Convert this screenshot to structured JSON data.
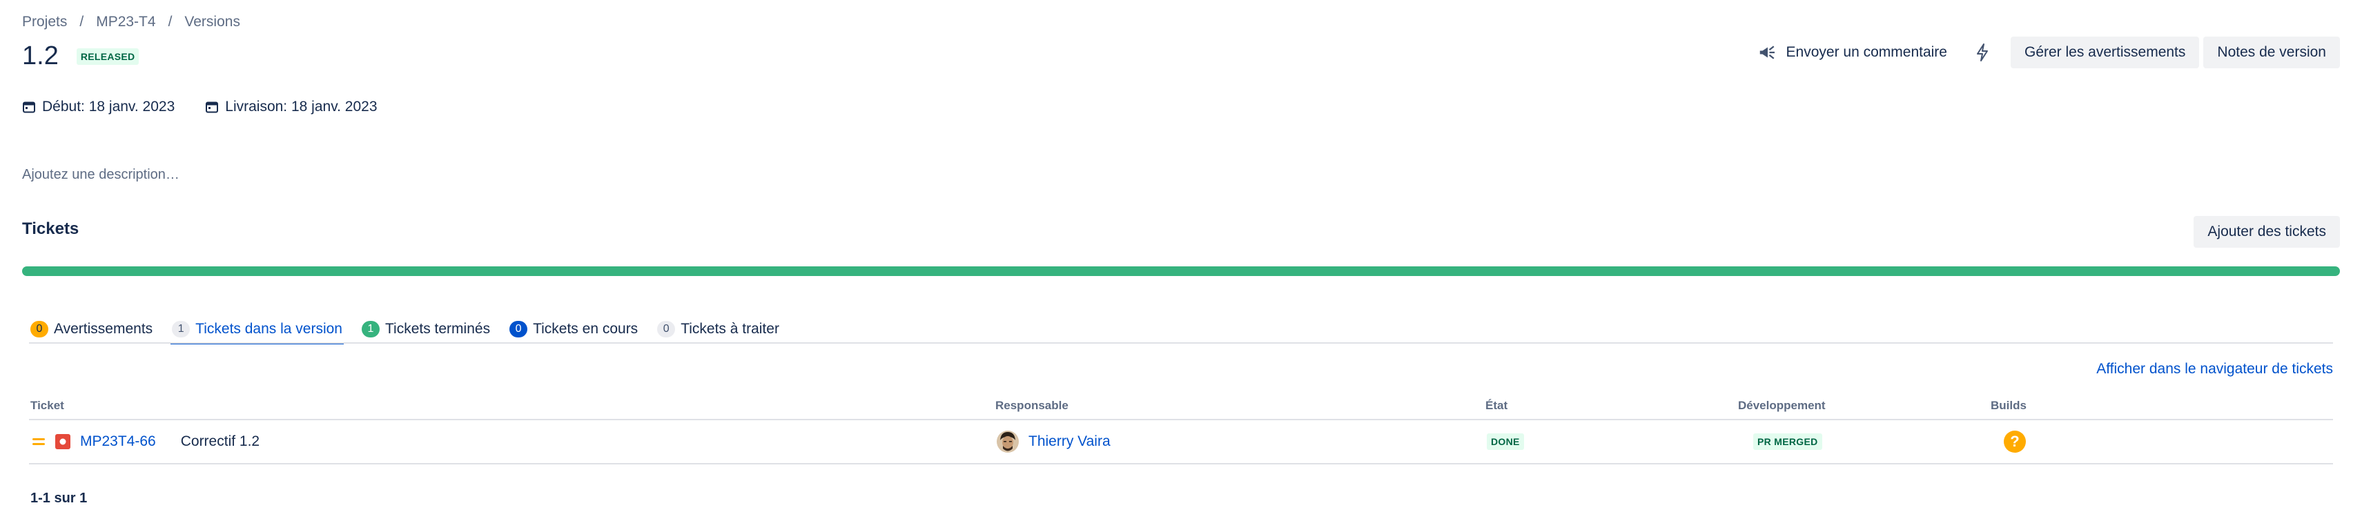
{
  "breadcrumb": [
    "Projets",
    "MP23-T4",
    "Versions"
  ],
  "version": {
    "title": "1.2",
    "status": "RELEASED",
    "start_date": "Début: 18 janv. 2023",
    "release_date": "Livraison: 18 janv. 2023",
    "description_placeholder": "Ajoutez une description…"
  },
  "header_actions": {
    "feedback": "Envoyer un commentaire",
    "bolt_icon": "lightning-icon",
    "manage_warnings": "Gérer les avertissements",
    "release_notes": "Notes de version"
  },
  "tickets_section": {
    "heading": "Tickets",
    "add_button": "Ajouter des tickets",
    "progress_done_fraction": 1.0,
    "progress_color": "#36b37e"
  },
  "tabs": [
    {
      "count": "0",
      "label": "Avertissements",
      "color": "yellow",
      "active": false
    },
    {
      "count": "1",
      "label": "Tickets dans la version",
      "color": "grey",
      "active": true
    },
    {
      "count": "1",
      "label": "Tickets terminés",
      "color": "green",
      "active": false
    },
    {
      "count": "0",
      "label": "Tickets en cours",
      "color": "blue",
      "active": false
    },
    {
      "count": "0",
      "label": "Tickets à traiter",
      "color": "grey",
      "active": false
    }
  ],
  "navigator_link": "Afficher dans le navigateur de tickets",
  "table": {
    "columns": [
      "Ticket",
      "Responsable",
      "État",
      "Développement",
      "Builds"
    ],
    "rows": [
      {
        "priority_icon": "medium-priority-icon",
        "type_icon": "bug-icon",
        "key": "MP23T4-66",
        "summary": "Correctif 1.2",
        "assignee": "Thierry Vaira",
        "status": "DONE",
        "development": "PR MERGED",
        "build_icon": "question-icon",
        "build_symbol": "?"
      }
    ]
  },
  "pagination": "1-1 sur 1",
  "colors": {
    "link": "#0052cc",
    "text": "#172b4d",
    "subtle": "#5e6c84",
    "success": "#36b37e",
    "warning": "#ffab00",
    "bug": "#e5493a"
  }
}
